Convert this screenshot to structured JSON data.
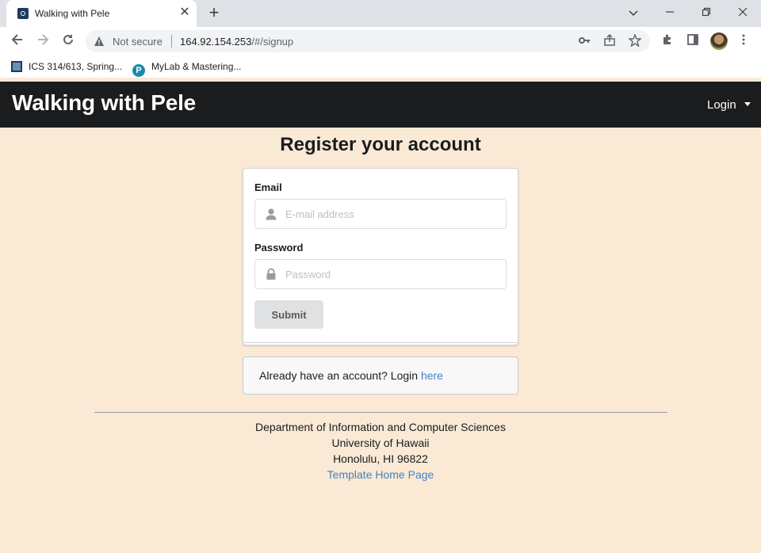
{
  "browser": {
    "tab_title": "Walking with Pele",
    "tab_close": "✕",
    "new_tab": "+",
    "security_label": "Not secure",
    "url_host": "164.92.154.253",
    "url_path": "/#/signup"
  },
  "bookmarks": [
    {
      "label": "ICS 314/613, Spring..."
    },
    {
      "label": "MyLab & Mastering..."
    }
  ],
  "navbar": {
    "brand": "Walking with Pele",
    "login_label": "Login"
  },
  "page": {
    "title": "Register your account"
  },
  "form": {
    "email_label": "Email",
    "email_placeholder": "E-mail address",
    "password_label": "Password",
    "password_placeholder": "Password",
    "submit_label": "Submit"
  },
  "message": {
    "text": "Already have an account? Login ",
    "link": "here"
  },
  "footer": {
    "line1": "Department of Information and Computer Sciences",
    "line2": "University of Hawaii",
    "line3": "Honolulu, HI 96822",
    "link": "Template Home Page"
  },
  "colors": {
    "page_bg": "#fae9d5",
    "navbar_bg": "#1b1c1d",
    "link": "#4183c4"
  }
}
